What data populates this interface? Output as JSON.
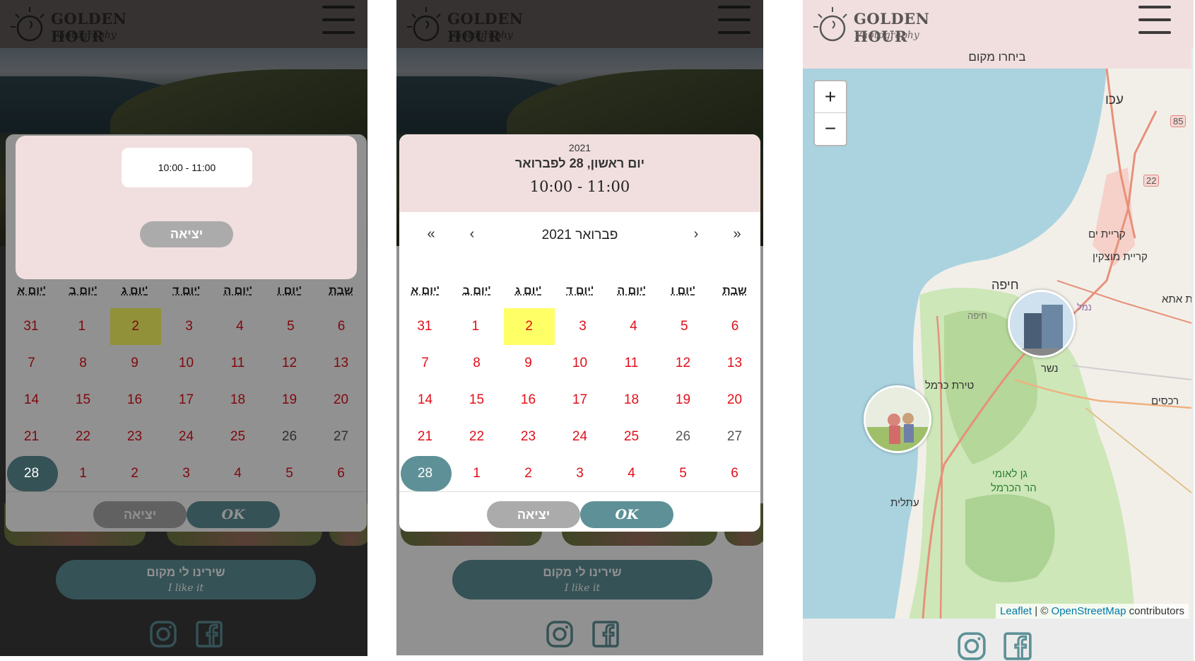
{
  "logo": {
    "title": "GOLDEN HOUR",
    "subtitle": "Photography"
  },
  "picker": {
    "year": "2021",
    "date_label": "יום ראשון, 28 לפברואר",
    "time": "10:00 - 11:00",
    "month_label": "פברואר 2021",
    "nav": {
      "first": "«",
      "prev": "‹",
      "next": "›",
      "last": "»"
    },
    "weekdays": [
      "יום א'",
      "יום ב'",
      "יום ג'",
      "יום ד'",
      "יום ה'",
      "יום ו'",
      "שבת"
    ],
    "weeks": [
      [
        "31",
        "1",
        "2",
        "3",
        "4",
        "5",
        "6"
      ],
      [
        "7",
        "8",
        "9",
        "10",
        "11",
        "12",
        "13"
      ],
      [
        "14",
        "15",
        "16",
        "17",
        "18",
        "19",
        "20"
      ],
      [
        "21",
        "22",
        "23",
        "24",
        "25",
        "26",
        "27"
      ],
      [
        "28",
        "1",
        "2",
        "3",
        "4",
        "5",
        "6"
      ]
    ],
    "today": "2",
    "selected": "28",
    "exit_label": "יציאה",
    "ok_label": "OK"
  },
  "time_popup": {
    "slot": "10:00 - 11:00",
    "exit_label": "יציאה"
  },
  "like_button": {
    "line1": "שירינו לי מקום",
    "line2": "I like it"
  },
  "map_screen": {
    "title": "ביחרו מקום",
    "zoom_in": "+",
    "zoom_out": "−",
    "labels": {
      "acre": "עכו",
      "kiryat_yam": "קריית ים",
      "kiryat_motzkin": "קריית מוצקין",
      "haifa": "חיפה",
      "haifa_small": "חיפה",
      "port": "נמל",
      "nesher": "נשר",
      "tirat_carmel": "טירת כרמל",
      "kiryat_ata": "ית אתא",
      "rechasim": "רכסים",
      "park1": "גן לאומי",
      "park2": "הר הכרמל",
      "atlit": "עתלית",
      "road85": "85",
      "road22": "22"
    },
    "attribution": {
      "leaflet": "Leaflet",
      "sep": " | © ",
      "osm": "OpenStreetMap",
      "rest": " contributors"
    }
  },
  "colors": {
    "brand_pink": "#f1dfdf",
    "teal": "#5e9197",
    "exit_gray": "#ababab",
    "day_red": "#e0101a",
    "today_yellow": "#ffff66"
  }
}
